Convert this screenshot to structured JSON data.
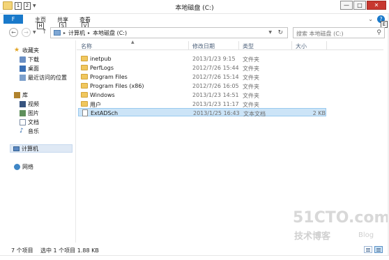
{
  "window": {
    "title": "本地磁盘 (C:)",
    "qat_keytips": [
      "1",
      "2"
    ],
    "controls": {
      "minimize": "—",
      "maximize": "□",
      "close": "✕"
    }
  },
  "ribbon": {
    "file_tab": "F",
    "tabs": [
      {
        "label": "主页",
        "keytip": "H"
      },
      {
        "label": "共享",
        "keytip": "S"
      },
      {
        "label": "查看",
        "keytip": "V"
      }
    ],
    "expand_glyph": "⌄",
    "help_glyph": "?",
    "extra_keytip": "E"
  },
  "address": {
    "back_glyph": "←",
    "forward_glyph": "→",
    "up_glyph": "↑",
    "crumbs": [
      "计算机",
      "本地磁盘 (C:)"
    ],
    "separator": "▸",
    "refresh_glyph": "↻"
  },
  "search": {
    "placeholder": "搜索 本地磁盘 (C:)",
    "icon_glyph": "⚲"
  },
  "navpane": {
    "favorites": "收藏夹",
    "downloads": "下载",
    "desktop": "桌面",
    "recent": "最近访问的位置",
    "libraries": "库",
    "videos": "视频",
    "pictures": "图片",
    "documents": "文档",
    "music": "音乐",
    "computer": "计算机",
    "network": "网络"
  },
  "columns": {
    "name": "名称",
    "date": "修改日期",
    "type": "类型",
    "size": "大小"
  },
  "files": [
    {
      "name": "inetpub",
      "date": "2013/1/23 9:15",
      "type": "文件夹",
      "size": "",
      "icon": "folder-icon"
    },
    {
      "name": "PerfLogs",
      "date": "2012/7/26 15:44",
      "type": "文件夹",
      "size": "",
      "icon": "folder-icon"
    },
    {
      "name": "Program Files",
      "date": "2012/7/26 15:14",
      "type": "文件夹",
      "size": "",
      "icon": "folder-icon"
    },
    {
      "name": "Program Files (x86)",
      "date": "2012/7/26 16:05",
      "type": "文件夹",
      "size": "",
      "icon": "folder-icon"
    },
    {
      "name": "Windows",
      "date": "2013/1/23 14:51",
      "type": "文件夹",
      "size": "",
      "icon": "folder-icon"
    },
    {
      "name": "用户",
      "date": "2013/1/23 11:17",
      "type": "文件夹",
      "size": "",
      "icon": "folder-icon"
    },
    {
      "name": "ExtADSch",
      "date": "2013/1/25 16:43",
      "type": "文本文档",
      "size": "2 KB",
      "icon": "text-file-icon",
      "selected": true
    }
  ],
  "status": {
    "item_count": "7 个项目",
    "selection": "选中 1 个项目  1.88 KB"
  },
  "watermark": {
    "main": "51CTO.com",
    "sub": "技术博客",
    "blog": "Blog"
  },
  "colors": {
    "accent": "#1979ca",
    "selection": "#cce4f7",
    "folder": "#f0c75e",
    "close": "#c7372f"
  }
}
